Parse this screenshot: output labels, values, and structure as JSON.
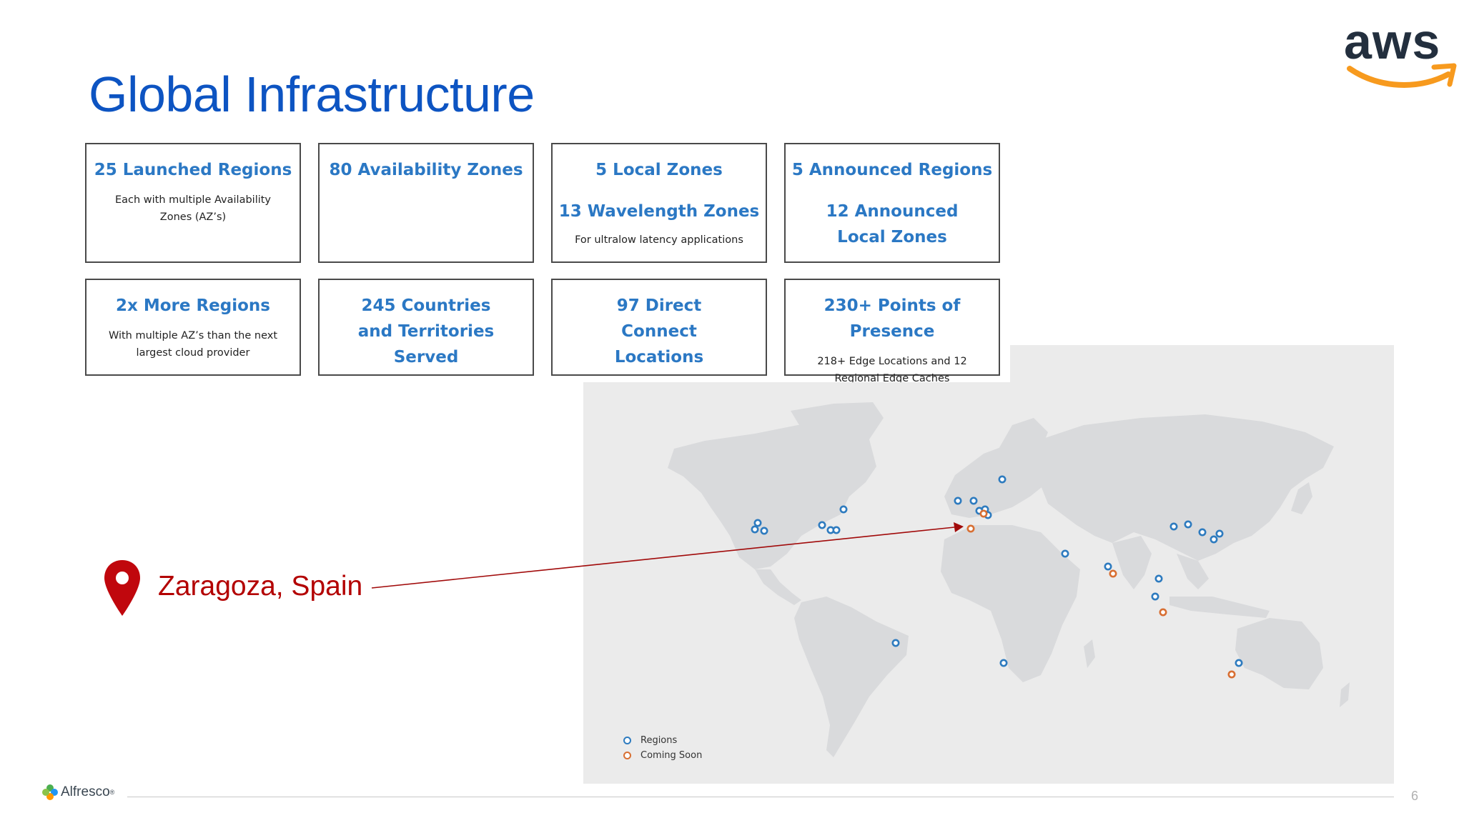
{
  "slide": {
    "title": "Global Infrastructure",
    "page_number": "6"
  },
  "logo": {
    "aws_text": "aws"
  },
  "cards": [
    {
      "heading": "25 Launched Regions",
      "sub": "Each with multiple Availability Zones (AZ’s)"
    },
    {
      "heading": "80 Availability Zones"
    },
    {
      "heading": "5 Local Zones",
      "heading2": "13 Wavelength Zones",
      "sub": "For ultralow latency applications"
    },
    {
      "heading": "5 Announced Regions",
      "heading2": "12 Announced Local Zones"
    },
    {
      "heading": "2x More Regions",
      "sub": "With multiple AZ’s than the next largest cloud provider"
    },
    {
      "heading": "245 Countries and Territories Served"
    },
    {
      "heading": "97 Direct Connect Locations"
    },
    {
      "heading": "230+ Points of Presence",
      "sub": "218+ Edge Locations and 12 Regional Edge Caches"
    }
  ],
  "map": {
    "legend": {
      "regions": "Regions",
      "coming_soon": "Coming Soon"
    },
    "colors": {
      "region": "#2e7bbf",
      "coming_soon": "#d86f33"
    }
  },
  "callout": {
    "label": "Zaragoza, Spain",
    "color": "#b30000"
  },
  "footer": {
    "brand": "Alfresco",
    "brand_mark": "®"
  }
}
